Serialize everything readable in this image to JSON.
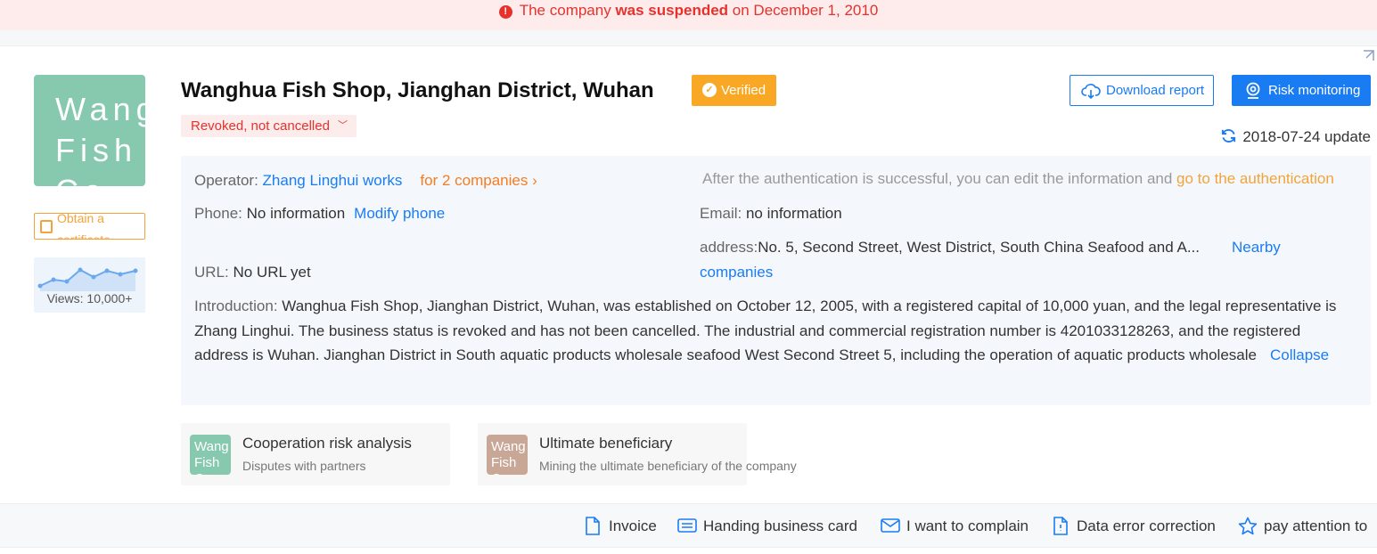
{
  "banner": {
    "prefix": "The company ",
    "bold": "was suspended",
    "suffix": " on December 1, 2010"
  },
  "logo": {
    "text": "Wang\nFish\nCo"
  },
  "certificate": {
    "label": "Obtain a certificate"
  },
  "views": {
    "label": "Views: 10,000+"
  },
  "company": {
    "title": "Wanghua Fish Shop, Jianghan District, Wuhan",
    "verified_label": "Verified",
    "status_tag": "Revoked, not cancelled"
  },
  "actions": {
    "download_label": "Download report",
    "risk_label": "Risk monitoring",
    "update_text": "2018-07-24 update"
  },
  "info": {
    "operator_label": "Operator: ",
    "operator_name": "Zhang Linghui works",
    "operator_companies": "for 2 companies",
    "auth_text": "After the authentication is successful, you can edit the information and ",
    "auth_link": "go to the authentication",
    "phone_label": "Phone: ",
    "phone_value": "No information",
    "phone_link": "Modify phone",
    "email_label": "Email: ",
    "email_value": "no information",
    "address_label": "address:",
    "address_value": "No. 5, Second Street, West District, South China Seafood and A...",
    "nearby_link_1": "Nearby",
    "nearby_link_2": "companies",
    "url_label": "URL: ",
    "url_value": "No URL yet",
    "intro_label": "Introduction: ",
    "intro_text": "Wanghua Fish Shop, Jianghan District, Wuhan, was established on October 12, 2005, with a registered capital of 10,000 yuan, and the legal representative is Zhang Linghui. The business status is revoked and has not been cancelled. The industrial and commercial registration number is 4201033128263, and the registered address is Wuhan. Jianghan District in South aquatic products wholesale seafood West Second Street 5, including the operation of aquatic products wholesale",
    "collapse_link": "Collapse"
  },
  "cards": [
    {
      "logo": "Wang\nFish\nCo",
      "logo_color": "#86c9ae",
      "title": "Cooperation risk analysis",
      "subtitle": "Disputes with partners"
    },
    {
      "logo": "Wang\nFish\nCo",
      "logo_color": "#c9a797",
      "title": "Ultimate beneficiary",
      "subtitle": "Mining the ultimate beneficiary of the company"
    }
  ],
  "bottom_actions": {
    "invoice": "Invoice",
    "business_card": "Handing business card",
    "complain": "I want to complain",
    "correction": "Data error correction",
    "follow": "pay attention to"
  },
  "colors": {
    "banner_red": "#e5322d",
    "accent_blue": "#1a7cf2",
    "verified_orange": "#f9a825",
    "link_orange": "#f77c21"
  }
}
